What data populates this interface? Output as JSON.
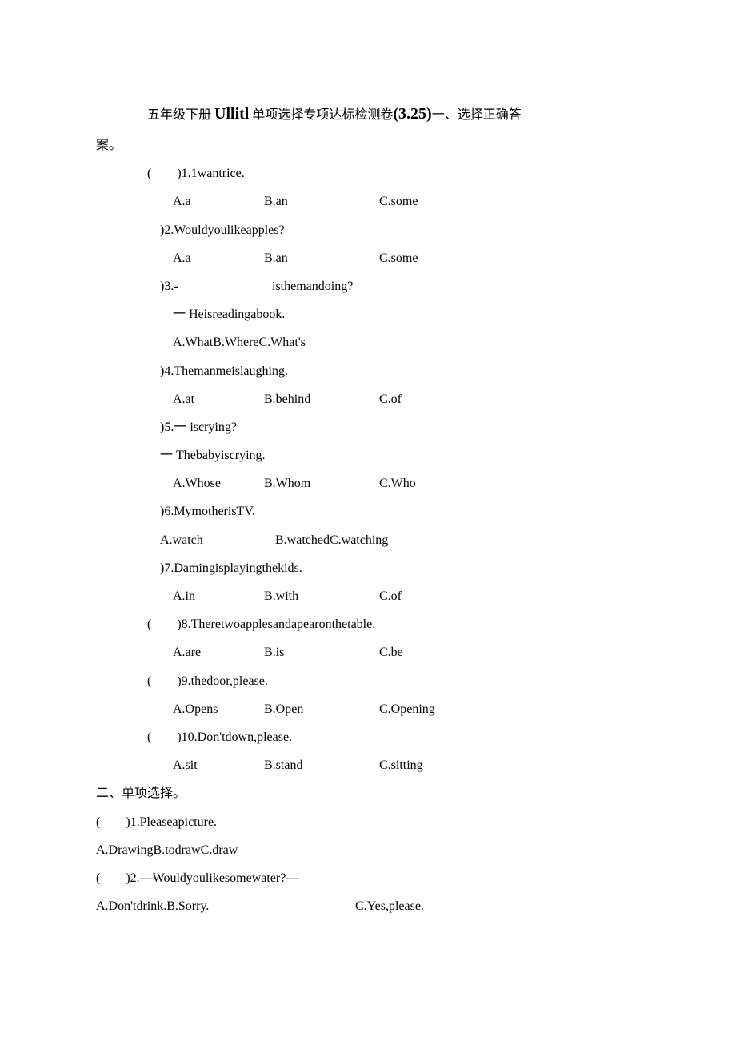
{
  "title": {
    "prefix": "五年级下册 ",
    "code": "Ullitl",
    "mid": " 单项选择专项达标检测卷",
    "paren": "(3.25)",
    "sec": "一、选择正确答",
    "tail": "案。"
  },
  "s1": {
    "q1": {
      "num": "(  )1.",
      "text": "1wantrice.",
      "a": "A.a",
      "b": "B.an",
      "c": "C.some"
    },
    "q2": {
      "num": ")2.",
      "text": "Wouldyoulikeapples?",
      "a": "A.a",
      "b": "B.an",
      "c": "C.some"
    },
    "q3": {
      "num": ")3.-",
      "text": "isthemandoing?",
      "ans": "一 Heisreadingabook.",
      "opts": "A.WhatB.WhereC.What's"
    },
    "q4": {
      "num": ")4.",
      "text": "Themanmeislaughing.",
      "a": "A.at",
      "b": "B.behind",
      "c": "C.of"
    },
    "q5": {
      "num": ")5.",
      "text": "一 iscrying?",
      "ans": "一 Thebabyiscrying.",
      "a": "A.Whose",
      "b": "B.Whom",
      "c": "C.Who"
    },
    "q6": {
      "num": ")6.",
      "text": "MymotherisTV.",
      "a": "A.watch",
      "bc": "B.watchedC.watching"
    },
    "q7": {
      "num": ")7.",
      "text": "Damingisplayingthekids.",
      "a": "A.in",
      "b": "B.with",
      "c": "C.of"
    },
    "q8": {
      "num": "(  )8.",
      "text": "Theretwoapplesandapearonthetable.",
      "a": "A.are",
      "b": "B.is",
      "c": "C.be"
    },
    "q9": {
      "num": "(  )9.",
      "text": "thedoor,please.",
      "a": "A.Opens",
      "b": "B.Open",
      "c": "C.Opening"
    },
    "q10": {
      "num": "(  )10.",
      "text": "Don'tdown,please.",
      "a": "A.sit",
      "b": "B.stand",
      "c": "C.sitting"
    }
  },
  "s2": {
    "heading": "二、单项选择。",
    "q1": {
      "num": "(  )1.",
      "text": "Pleaseapicture.",
      "opts": "A.DrawingB.todrawC.draw"
    },
    "q2": {
      "num": "(  )2.",
      "text": "—Wouldyoulikesomewater?—",
      "a": "A.Don'tdrink.B.Sorry.",
      "c": "C.Yes,please."
    }
  }
}
